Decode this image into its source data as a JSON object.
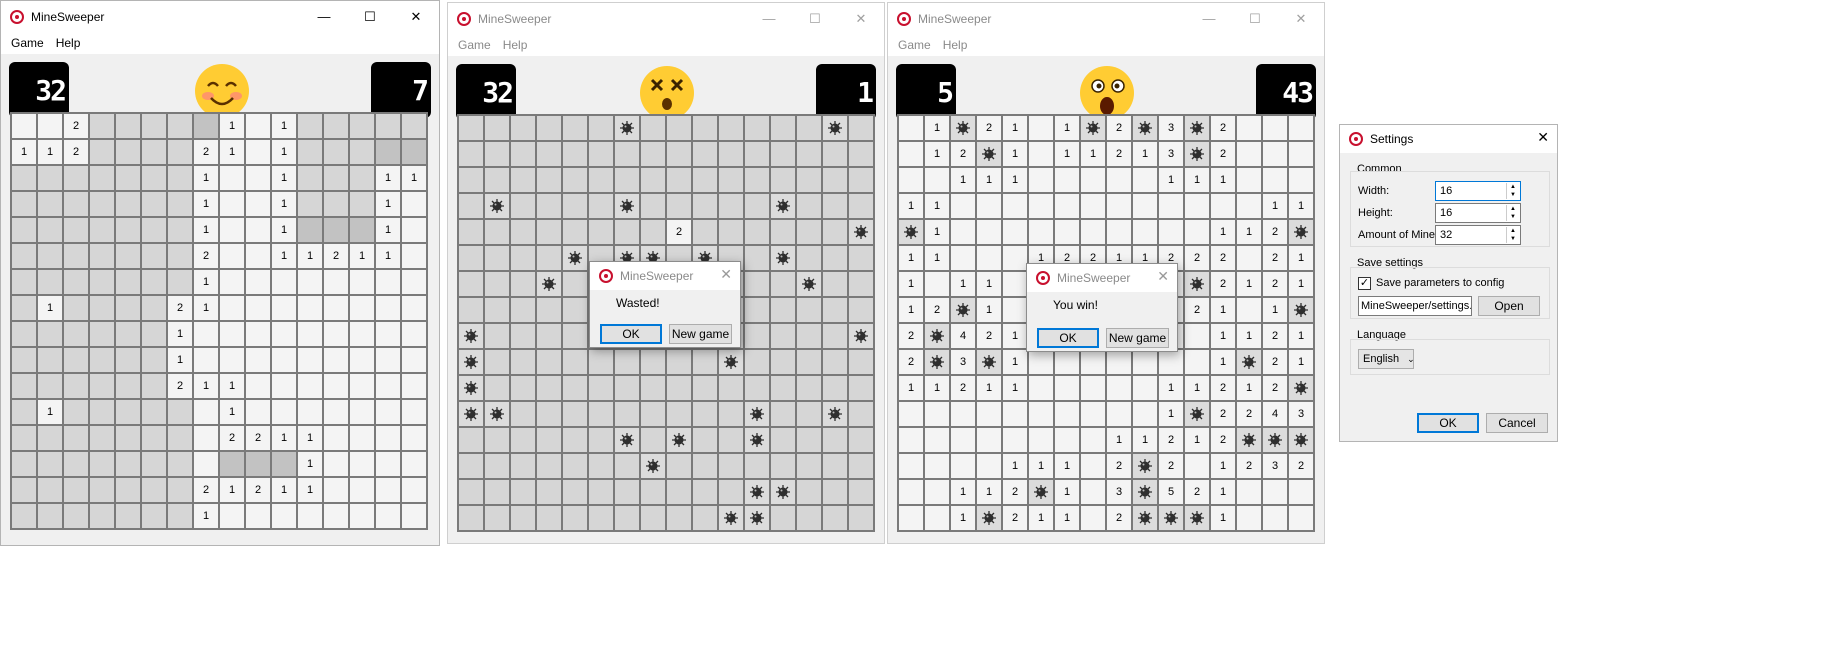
{
  "app_title": "MineSweeper",
  "menu": [
    "Game",
    "Help"
  ],
  "windows": [
    {
      "state": "playing",
      "mines_counter": "32",
      "timer": "7",
      "face": "blushing-smile",
      "rows": [
        "hho2hhhs1oo1hhhh",
        "1o12hhhh21oo1hhh",
        "hhhhhhhh1oo1hhh11",
        "hhhhhhhh1oo1hhh1o",
        "hhhhhhhh1oo1hhh1o",
        "hhhhhhhh2ooo1121 1",
        "hhhhhhhh1ooooooo",
        "h1hhhhh21ooooooo",
        "hhhhhhh1oooooooo",
        "hhhhhhh1oooooooo",
        "hhhhhhh211oooooo",
        "h1hhhhhs1ooooooo",
        "hhhhhhhh2211oooo",
        "hhhhhhhhsss1oooo",
        "hhhhhhhh21211ooo",
        "hhhhhhhh1ooooooo"
      ]
    },
    {
      "state": "lost",
      "mines_counter": "32",
      "timer": "1",
      "face": "dead-x-eyes",
      "dialog": {
        "title": "MineSweeper",
        "message": "Wasted!",
        "ok": "OK",
        "new_game": "New game"
      }
    },
    {
      "state": "won",
      "mines_counter": "5",
      "timer": "43",
      "face": "shocked-open-mouth",
      "dialog": {
        "title": "MineSweeper",
        "message": "You win!",
        "ok": "OK",
        "new_game": "New game"
      }
    }
  ],
  "settings": {
    "title": "Settings",
    "common_label": "Common",
    "width_label": "Width:",
    "width_value": "16",
    "height_label": "Height:",
    "height_value": "16",
    "mines_label": "Amount of Mines:",
    "mines_value": "32",
    "save_label": "Save settings",
    "save_checkbox_label": "Save parameters to config",
    "save_checked": true,
    "config_path": "MineSweeper/settings.json",
    "open_button": "Open",
    "language_label": "Language",
    "language_value": "English",
    "ok": "OK",
    "cancel": "Cancel"
  },
  "colors": {
    "accent": "#0078d7",
    "counter_bg": "#000000",
    "icon_red": "#c8102e"
  }
}
